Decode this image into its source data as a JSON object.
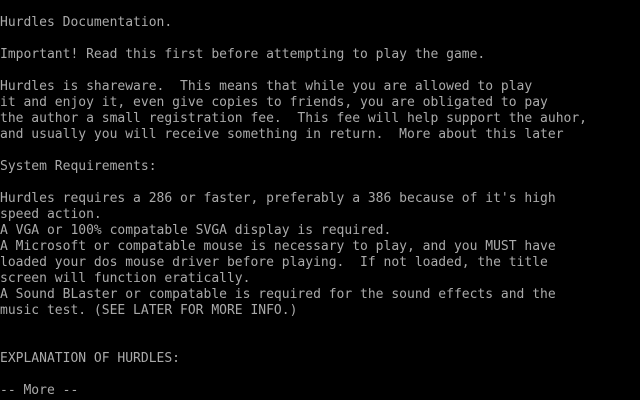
{
  "document": {
    "title": "Hurdles Documentation.",
    "important": "Important! Read this first before attempting to play the game.",
    "shareware_paragraph": [
      "Hurdles is shareware.  This means that while you are allowed to play",
      "it and enjoy it, even give copies to friends, you are obligated to pay",
      "the author a small registration fee.  This fee will help support the auhor,",
      "and usually you will receive something in return.  More about this later"
    ],
    "requirements_heading": "System Requirements:",
    "requirements_lines": [
      "Hurdles requires a 286 or faster, preferably a 386 because of it's high",
      "speed action.",
      "A VGA or 100% compatable SVGA display is required.",
      "A Microsoft or compatable mouse is necessary to play, and you MUST have",
      "loaded your dos mouse driver before playing.  If not loaded, the title",
      "screen will function eratically.",
      "A Sound BLaster or compatable is required for the sound effects and the",
      "music test. (SEE LATER FOR MORE INFO.)"
    ],
    "explanation_heading": "EXPLANATION OF HURDLES:"
  },
  "pager": {
    "prompt": "-- More --"
  },
  "colors": {
    "background": "#000000",
    "text": "#aaaaaa"
  }
}
